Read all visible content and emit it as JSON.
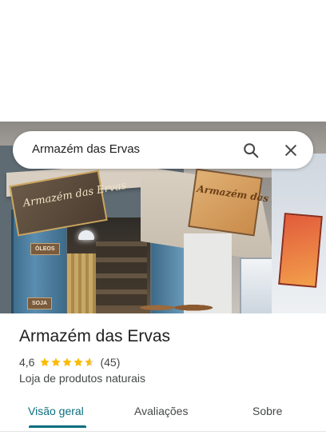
{
  "search": {
    "value": "Armazém das Ervas"
  },
  "place": {
    "name": "Armazém das Ervas",
    "rating": "4,6",
    "stars": 4.6,
    "review_count": "(45)",
    "category": "Loja de produtos naturais"
  },
  "photo": {
    "sign_left": "Armazém das Ervas",
    "banner_right": "Armazém das Ervas",
    "plate_oleos": "ÓLEOS",
    "plate_soja": "SOJA"
  },
  "tabs": [
    {
      "label": "Visão geral",
      "active": true
    },
    {
      "label": "Avaliações",
      "active": false
    },
    {
      "label": "Sobre",
      "active": false
    }
  ],
  "colors": {
    "accent": "#0b6e7f",
    "star": "#fbbc04",
    "star_empty": "#dadce0"
  },
  "icons": {
    "search": "search-icon",
    "close": "close-icon"
  }
}
